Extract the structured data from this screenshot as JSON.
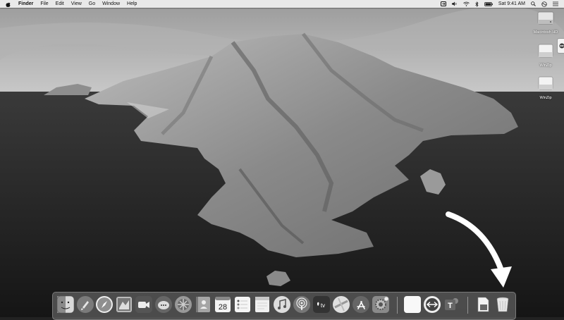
{
  "menubar": {
    "app_name": "Finder",
    "menus": [
      "File",
      "Edit",
      "View",
      "Go",
      "Window",
      "Help"
    ],
    "clock": "Sat 9:41 AM",
    "status_icons": [
      "teamviewer-icon",
      "volume-icon",
      "wifi-icon",
      "bluetooth-icon",
      "battery-icon",
      "search-icon",
      "siri-icon",
      "menu-list-icon"
    ]
  },
  "desktop": {
    "icons": [
      {
        "label": "Macintosh HD",
        "icon": "hard-drive-icon"
      },
      {
        "label": "WinZip",
        "icon": "disk-image-icon"
      },
      {
        "label": "WinZip",
        "icon": "disk-image-icon"
      }
    ]
  },
  "dock": {
    "apps": [
      {
        "name": "Finder",
        "icon": "finder-icon"
      },
      {
        "name": "Launchpad",
        "icon": "launchpad-icon"
      },
      {
        "name": "Safari",
        "icon": "safari-icon"
      },
      {
        "name": "Mail",
        "icon": "mail-icon"
      },
      {
        "name": "FaceTime",
        "icon": "facetime-icon"
      },
      {
        "name": "Messages",
        "icon": "messages-icon"
      },
      {
        "name": "Photos",
        "icon": "photos-icon"
      },
      {
        "name": "Contacts",
        "icon": "contacts-icon"
      },
      {
        "name": "Calendar",
        "icon": "calendar-icon",
        "text": "28"
      },
      {
        "name": "Reminders",
        "icon": "reminders-icon"
      },
      {
        "name": "Notes",
        "icon": "notes-icon"
      },
      {
        "name": "Music",
        "icon": "music-icon"
      },
      {
        "name": "Podcasts",
        "icon": "podcasts-icon"
      },
      {
        "name": "TV",
        "icon": "tv-icon",
        "text": "tv"
      },
      {
        "name": "Maps",
        "icon": "maps-icon"
      },
      {
        "name": "App Store",
        "icon": "app-store-icon"
      },
      {
        "name": "System Preferences",
        "icon": "system-preferences-icon"
      },
      {
        "name": "Blank App",
        "icon": "blank-app-icon"
      },
      {
        "name": "TeamViewer",
        "icon": "teamviewer-icon"
      },
      {
        "name": "Teams",
        "icon": "teams-icon",
        "text": "T"
      },
      {
        "name": "Downloads",
        "icon": "downloads-stack-icon"
      },
      {
        "name": "Trash",
        "icon": "trash-icon"
      }
    ]
  },
  "annotation": {
    "icon": "curved-arrow-icon"
  }
}
